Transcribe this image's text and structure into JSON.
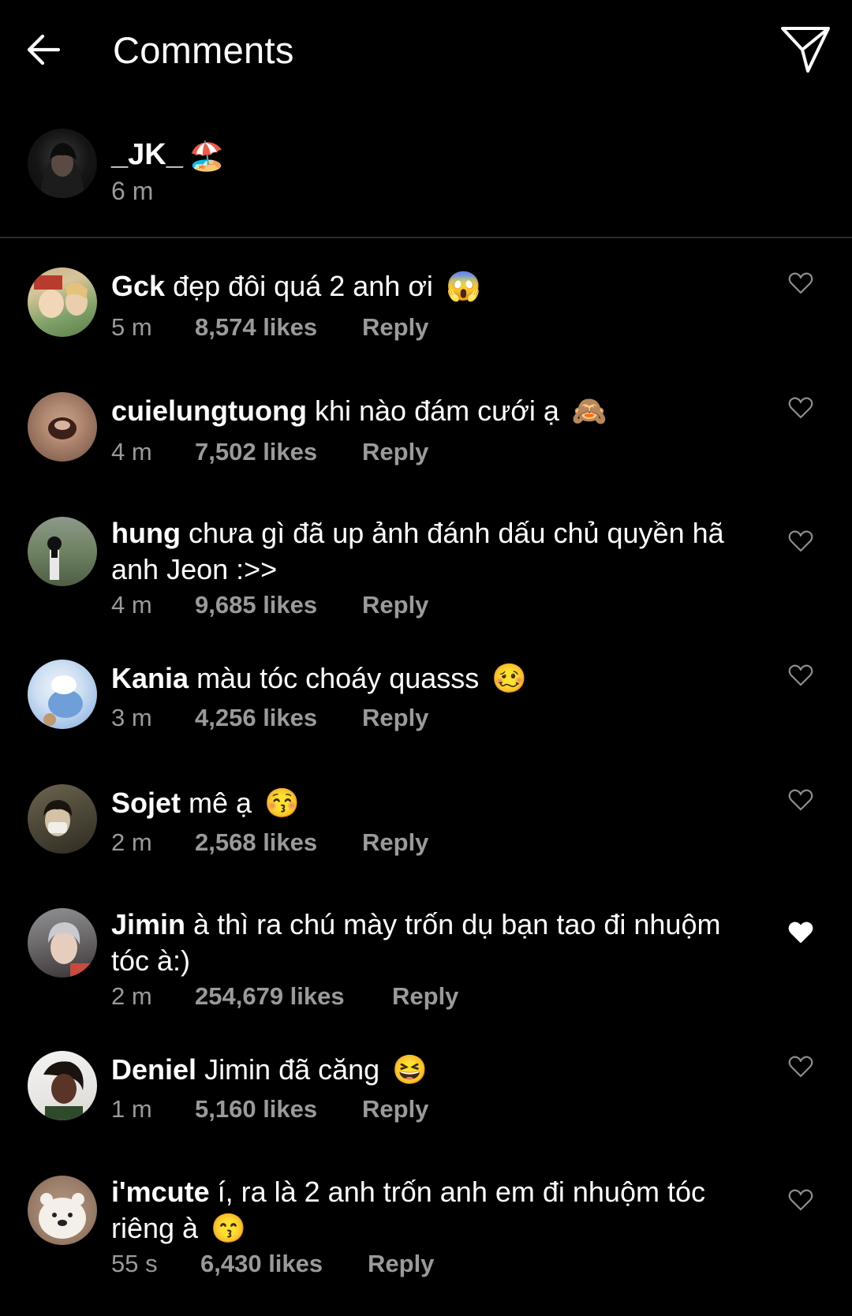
{
  "header": {
    "title": "Comments",
    "back_icon": "arrow-left-icon",
    "share_icon": "paper-plane-send-icon"
  },
  "caption": {
    "username": "_JK_",
    "emoji": "🏖️",
    "time": "6 m"
  },
  "comments": [
    {
      "user": "Gck",
      "text": "đẹp đôi quá 2 anh ơi",
      "emoji": "😱",
      "time": "5 m",
      "likes": "8,574 likes",
      "reply": "Reply",
      "liked": false
    },
    {
      "user": "cuielungtuong",
      "text": "khi nào đám cưới ạ",
      "emoji": "🙈",
      "time": "4 m",
      "likes": "7,502 likes",
      "reply": "Reply",
      "liked": false
    },
    {
      "user": "hung",
      "text": "chưa gì đã up ảnh đánh dấu chủ quyền hã anh Jeon :>>",
      "emoji": "",
      "time": "4 m",
      "likes": "9,685 likes",
      "reply": "Reply",
      "liked": false
    },
    {
      "user": "Kania",
      "text": "màu tóc choáy quasss",
      "emoji": "🥴",
      "time": "3 m",
      "likes": "4,256 likes",
      "reply": "Reply",
      "liked": false
    },
    {
      "user": "Sojet",
      "text": "mê ạ",
      "emoji": "😚",
      "time": "2 m",
      "likes": "2,568 likes",
      "reply": "Reply",
      "liked": false
    },
    {
      "user": "Jimin",
      "text": "à thì ra chú mày trốn dụ bạn tao đi nhuộm tóc à:)",
      "emoji": "",
      "time": "2 m",
      "likes": "254,679 likes",
      "reply": "Reply",
      "liked": true
    },
    {
      "user": "Deniel",
      "text": "Jimin đã căng",
      "emoji": "😆",
      "time": "1 m",
      "likes": "5,160 likes",
      "reply": "Reply",
      "liked": false
    },
    {
      "user": "i'mcute",
      "text": "í, ra là 2 anh trốn anh em đi nhuộm tóc riêng à",
      "emoji": "😙",
      "time": "55 s",
      "likes": "6,430 likes",
      "reply": "Reply",
      "liked": false
    }
  ],
  "colors": {
    "background": "#000000",
    "text": "#ffffff",
    "secondary_text": "#9a9a9a",
    "divider": "#2a2a2a"
  }
}
